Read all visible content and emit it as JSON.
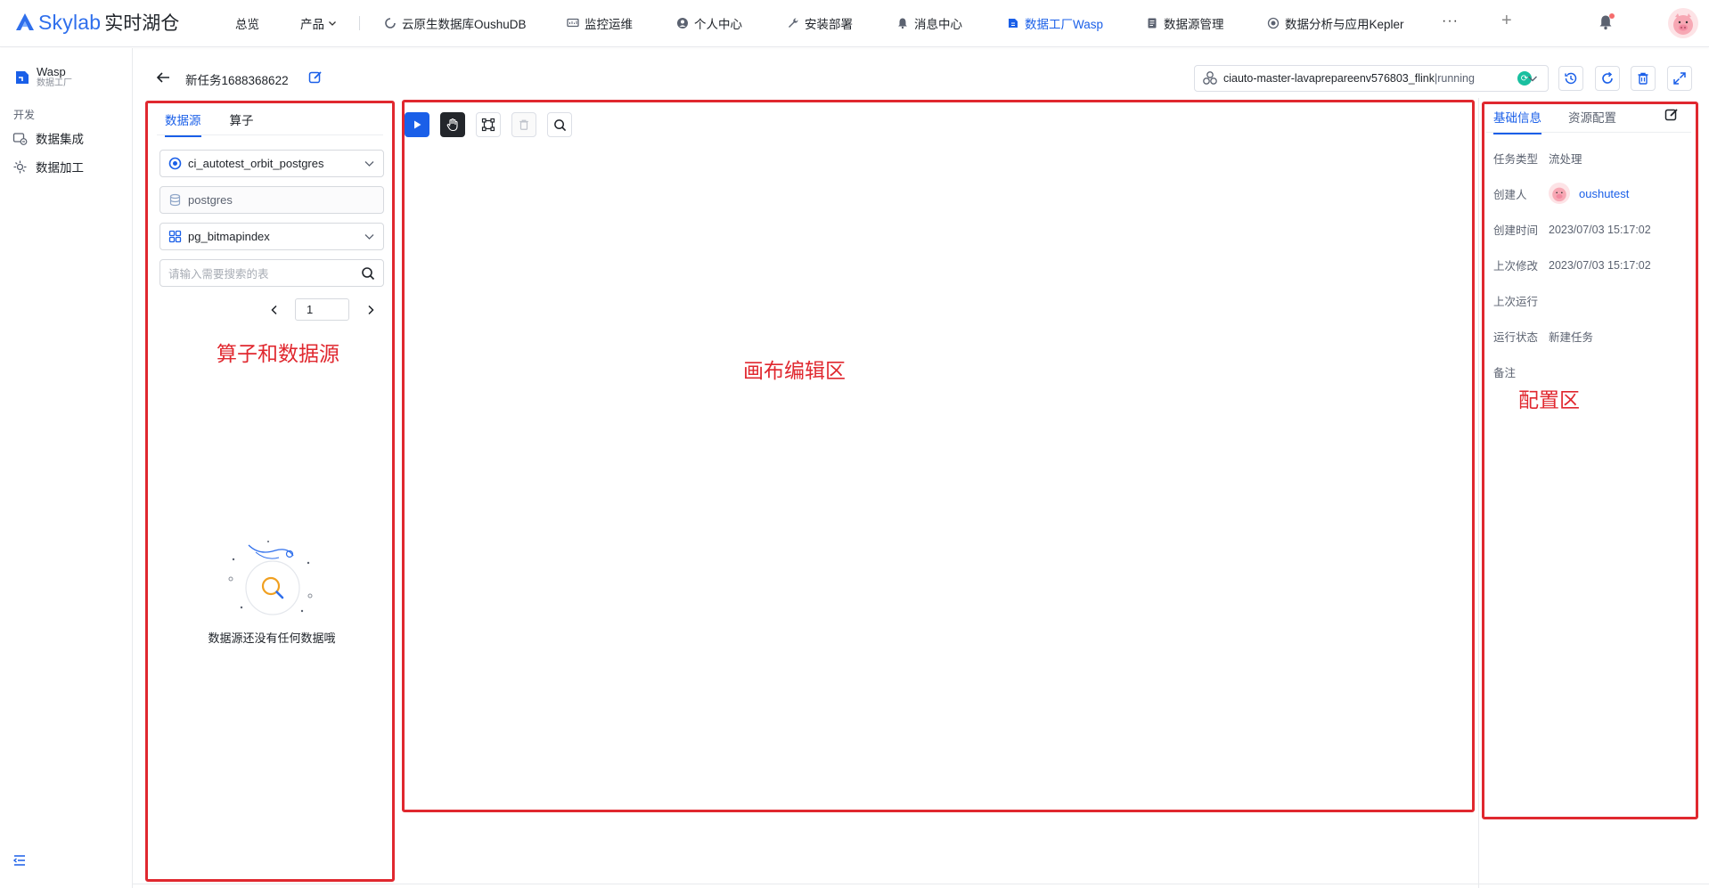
{
  "brand": {
    "name": "Skylab",
    "subtitle": "实时湖仓"
  },
  "nav": {
    "overview": "总览",
    "product": "产品",
    "oushudb": "云原生数据库OushuDB",
    "monitor": "监控运维",
    "personal": "个人中心",
    "deploy": "安装部署",
    "messages": "消息中心",
    "wasp": "数据工厂Wasp",
    "datasource_mgmt": "数据源管理",
    "kepler": "数据分析与应用Kepler",
    "more": "···",
    "add": "+"
  },
  "sidebar": {
    "app_name": "Wasp",
    "app_sub": "数据工厂",
    "group": "开发",
    "items": [
      {
        "label": "数据集成"
      },
      {
        "label": "数据加工"
      }
    ]
  },
  "task": {
    "name": "新任务1688368622",
    "cluster": "ciauto-master-lavaprepareenv576803_flink",
    "cluster_status": "|running"
  },
  "left_panel": {
    "tabs": [
      "数据源",
      "算子"
    ],
    "datasource": "ci_autotest_orbit_postgres",
    "database": "postgres",
    "schema": "pg_bitmapindex",
    "search_placeholder": "请输入需要搜索的表",
    "page": "1",
    "empty_text": "数据源还没有任何数据哦"
  },
  "annotations": {
    "left": "算子和数据源",
    "canvas": "画布编辑区",
    "right": "配置区"
  },
  "right_panel": {
    "tabs": [
      "基础信息",
      "资源配置"
    ],
    "rows": [
      {
        "key": "任务类型",
        "value": "流处理"
      },
      {
        "key": "创建人",
        "value": "oushutest"
      },
      {
        "key": "创建时间",
        "value": "2023/07/03 15:17:02"
      },
      {
        "key": "上次修改",
        "value": "2023/07/03 15:17:02"
      },
      {
        "key": "上次运行",
        "value": ""
      },
      {
        "key": "运行状态",
        "value": "新建任务"
      },
      {
        "key": "备注",
        "value": ""
      }
    ]
  },
  "colors": {
    "accent": "#1a5fe8",
    "annotation": "#e0282f",
    "running": "#19c0a0"
  }
}
